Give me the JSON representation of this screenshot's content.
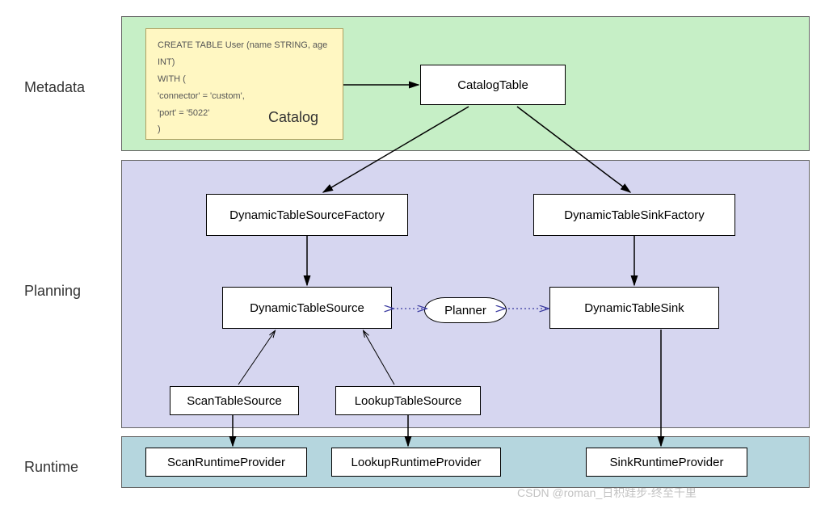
{
  "sections": {
    "metadata": "Metadata",
    "planning": "Planning",
    "runtime": "Runtime"
  },
  "catalog": {
    "line1": "CREATE TABLE User (name STRING, age INT)",
    "line2": "WITH (",
    "line3": "    'connector' = 'custom',",
    "line4": "    'port' = '5022'",
    "line5": ")",
    "label": "Catalog"
  },
  "nodes": {
    "catalogTable": "CatalogTable",
    "sourceFactory": "DynamicTableSourceFactory",
    "sinkFactory": "DynamicTableSinkFactory",
    "tableSource": "DynamicTableSource",
    "planner": "Planner",
    "tableSink": "DynamicTableSink",
    "scanTableSource": "ScanTableSource",
    "lookupTableSource": "LookupTableSource",
    "scanRuntime": "ScanRuntimeProvider",
    "lookupRuntime": "LookupRuntimeProvider",
    "sinkRuntime": "SinkRuntimeProvider"
  },
  "watermark": "CSDN @roman_日积跬步-终至千里"
}
